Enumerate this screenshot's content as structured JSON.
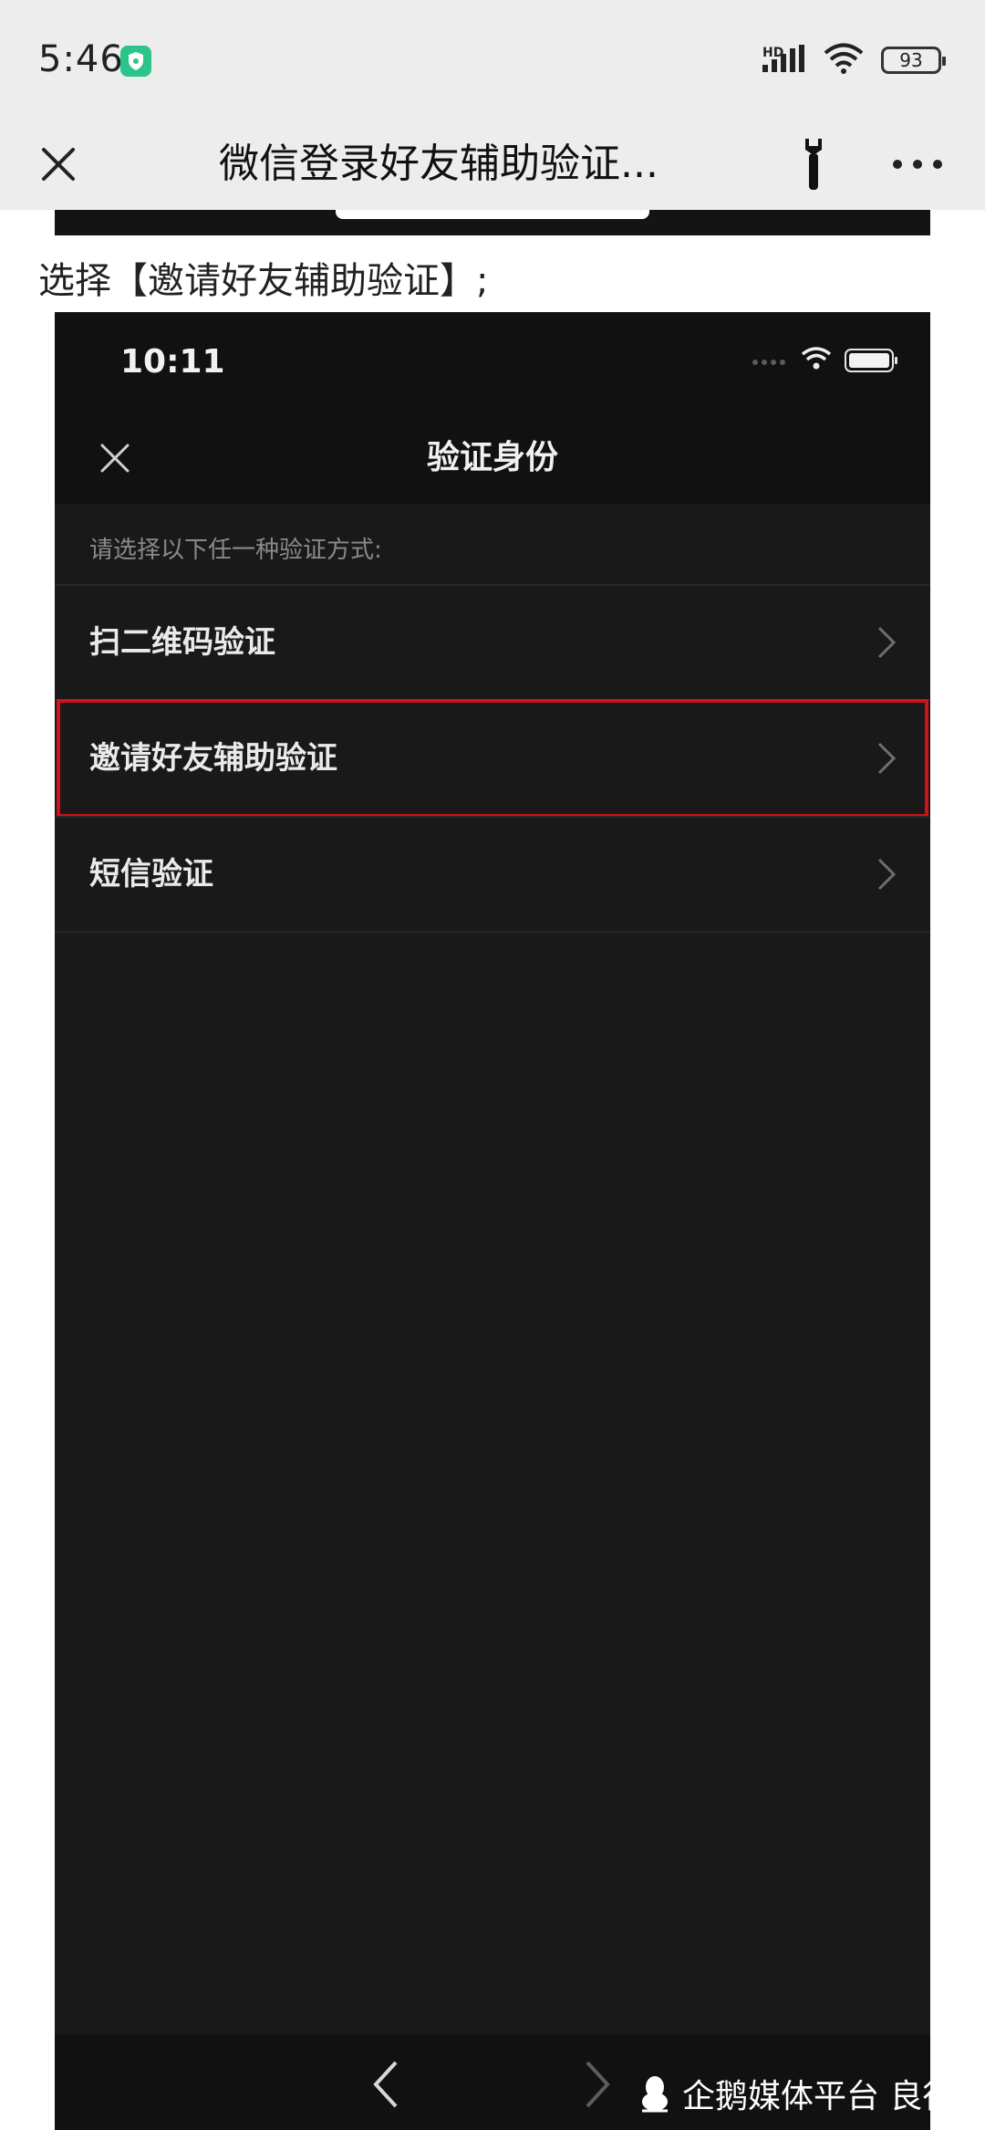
{
  "status_bar": {
    "time": "5:46",
    "network_label": "HD",
    "battery": "93"
  },
  "nav": {
    "title": "微信登录好友辅助验证..."
  },
  "article": {
    "instruction": "选择【邀请好友辅助验证】;"
  },
  "screenshot": {
    "time": "10:11",
    "title": "验证身份",
    "hint": "请选择以下任一种验证方式:",
    "options": [
      {
        "label": "扫二维码验证"
      },
      {
        "label": "邀请好友辅助验证",
        "highlighted": true
      },
      {
        "label": "短信验证"
      }
    ],
    "highlight_color": "#d0121b"
  },
  "watermark": {
    "text": "企鹅媒体平台 良行"
  }
}
